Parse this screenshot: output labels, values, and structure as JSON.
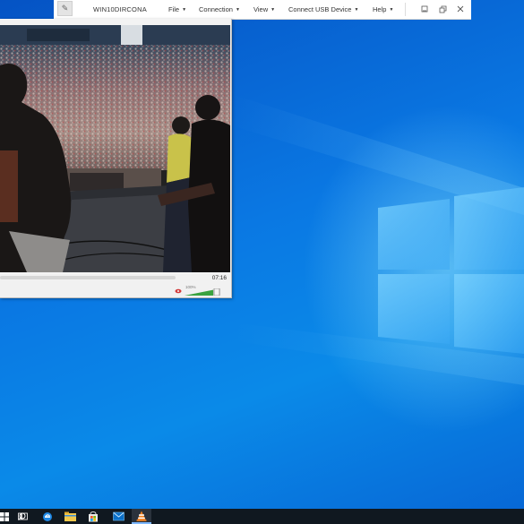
{
  "remote_toolbar": {
    "host_name": "WIN10DIRCONA",
    "pin_icon": "pin-icon",
    "menus": [
      {
        "label": "File"
      },
      {
        "label": "Connection"
      },
      {
        "label": "View"
      },
      {
        "label": "Connect USB Device"
      },
      {
        "label": "Help"
      }
    ],
    "window_buttons": [
      "minimize-icon",
      "restore-icon",
      "close-icon"
    ]
  },
  "player": {
    "elapsed_time": "07:16",
    "volume_label": "100%",
    "seek_progress": 0.0,
    "volume_level": 1.0
  },
  "taskbar": {
    "items": [
      "start-icon",
      "search-icon",
      "task-view-icon",
      "edge-icon",
      "file-explorer-icon",
      "store-icon",
      "mail-icon",
      "vlc-icon"
    ]
  },
  "colors": {
    "desktop_blue": "#0a78e3",
    "taskbar": "#101820",
    "volume_green": "#3aa340"
  }
}
